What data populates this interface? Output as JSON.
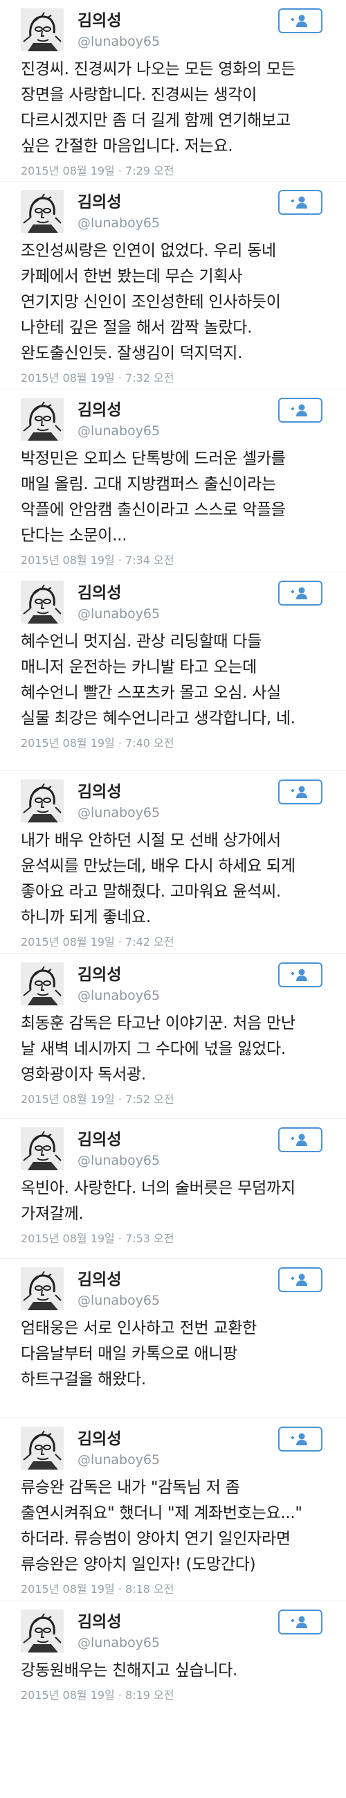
{
  "tweets": [
    {
      "display_name": "김의성",
      "handle": "@lunaboy65",
      "text": "진경씨. 진경씨가 나오는 모든 영화의 모든\n장면을 사랑합니다. 진경씨는 생각이\n다르시겠지만 좀 더 길게 함께 연기해보고\n싶은 간절한 마음입니다. 저는요.",
      "timestamp": "2015년 08월 19일 · 7:29 오전"
    },
    {
      "display_name": "김의성",
      "handle": "@lunaboy65",
      "text": "조인성씨랑은 인연이 없었다. 우리 동네\n카페에서 한번 봤는데 무슨 기획사\n연기지망 신인이 조인성한테 인사하듯이\n나한테 깊은 절을 해서 깜짝 놀랐다.\n완도출신인듯. 잘생김이 덕지덕지.",
      "timestamp": "2015년 08월 19일 · 7:32 오전"
    },
    {
      "display_name": "김의성",
      "handle": "@lunaboy65",
      "text": "박정민은 오피스 단톡방에 드러운 셀카를\n매일 올림. 고대 지방캠퍼스 출신이라는\n악플에 안암캠 출신이라고 스스로 악플을\n단다는 소문이...",
      "timestamp": "2015년 08월 19일 · 7:34 오전"
    },
    {
      "display_name": "김의성",
      "handle": "@lunaboy65",
      "text": "혜수언니 멋지심. 관상 리딩할때 다들\n매니저 운전하는 카니발 타고 오는데\n혜수언니 빨간 스포츠카 몰고 오심. 사실\n실물 최강은 혜수언니라고 생각합니다, 네.",
      "timestamp": "2015년 08월 19일 · 7:40 오전"
    },
    {
      "display_name": "김의성",
      "handle": "@lunaboy65",
      "text": "내가 배우 안하던 시절 모 선배 상가에서\n윤석씨를 만났는데, 배우 다시 하세요 되게\n좋아요 라고 말해줬다. 고마워요 윤석씨.\n하니까 되게 좋네요.",
      "timestamp": "2015년 08월 19일 · 7:42 오전"
    },
    {
      "display_name": "김의성",
      "handle": "@lunaboy65",
      "text": "최동훈 감독은 타고난 이야기꾼. 처음 만난\n날 새벽 네시까지 그 수다에 넋을 잃었다.\n영화광이자 독서광.",
      "timestamp": "2015년 08월 19일 · 7:52 오전"
    },
    {
      "display_name": "김의성",
      "handle": "@lunaboy65",
      "text": "옥빈아. 사랑한다. 너의 술버릇은 무덤까지\n가져갈께.",
      "timestamp": "2015년 08월 19일 · 7:53 오전"
    },
    {
      "display_name": "김의성",
      "handle": "@lunaboy65",
      "text": "엄태웅은 서로 인사하고 전번 교환한\n다음날부터 매일 카톡으로 애니팡\n하트구걸을 해왔다.",
      "timestamp": ""
    },
    {
      "display_name": "김의성",
      "handle": "@lunaboy65",
      "text": "류승완 감독은 내가 \"감독님 저 좀\n출연시켜줘요\" 했더니 \"제 계좌번호는요...\"\n하더라. 류승범이 양아치 연기 일인자라면\n류승완은 양아치 일인자! (도망간다)",
      "timestamp": "2015년 08월 19일 · 8:18 오전"
    },
    {
      "display_name": "김의성",
      "handle": "@lunaboy65",
      "text": "강동원배우는 친해지고 싶습니다.",
      "timestamp": "2015년 08월 19일 · 8:19 오전"
    }
  ],
  "icons": {
    "follow": "person-plus-icon",
    "avatar": "avatar-illustration"
  },
  "colors": {
    "accent": "#4a93d6",
    "muted": "#8f98a0",
    "text": "#1c1c1c"
  }
}
